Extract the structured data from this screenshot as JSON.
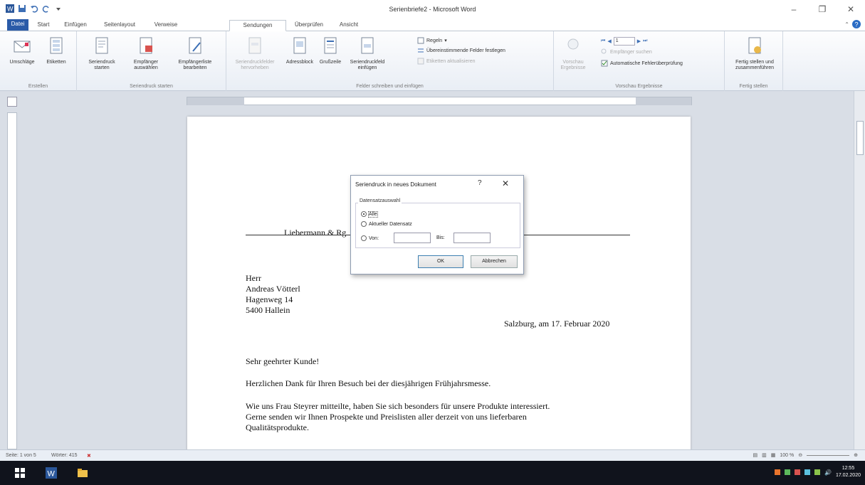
{
  "window": {
    "title": "Serienbriefe2 - Microsoft Word"
  },
  "tabs": [
    {
      "label": "Datei"
    },
    {
      "label": "Start"
    },
    {
      "label": "Einfügen"
    },
    {
      "label": "Seitenlayout"
    },
    {
      "label": "Verweise"
    },
    {
      "label": "Sendungen"
    },
    {
      "label": "Überprüfen"
    },
    {
      "label": "Ansicht"
    }
  ],
  "ribbon": {
    "erstellen": {
      "label": "Erstellen",
      "umschlaege": "Umschläge",
      "etiketten": "Etiketten"
    },
    "seriendruck_starten": {
      "label": "Seriendruck starten",
      "starten": "Seriendruck starten",
      "empfaenger": "Empfänger auswählen",
      "bearbeiten": "Empfängerliste bearbeiten"
    },
    "felder": {
      "label": "Felder schreiben und einfügen",
      "hervorheben": "Seriendruckfelder hervorheben",
      "adressblock": "Adressblock",
      "grusszeile": "Grußzeile",
      "feld_einfuegen": "Seriendruckfeld einfügen",
      "regeln": "Regeln",
      "uebereinstimmen": "Übereinstimmende Felder festlegen",
      "aktualisieren": "Etiketten aktualisieren"
    },
    "vorschau": {
      "label": "Vorschau Ergebnisse",
      "vorschau_btn": "Vorschau Ergebnisse",
      "record": "1",
      "empfaenger_suchen": "Empfänger suchen",
      "fehlerpruefung": "Automatische Fehlerüberprüfung"
    },
    "fertig": {
      "label": "Fertig stellen",
      "btn": "Fertig stellen und zusammenführen"
    }
  },
  "document": {
    "sender": "Liebermann & Rg",
    "recipient": [
      "Herr",
      "Andreas Vötterl",
      "Hagenweg 14",
      "5400   Hallein"
    ],
    "date": "Salzburg, am 17. Februar 2020",
    "salutation": "Sehr geehrter Kunde!",
    "p1": "Herzlichen Dank für Ihren Besuch bei der diesjährigen Frühjahrsmesse.",
    "p2_lines": [
      "Wie uns Frau Steyrer mitteilte, haben Sie sich besonders für unsere Produkte interessiert.",
      "Gerne senden wir Ihnen Prospekte und Preislisten  aller  derzeit von uns lieferbaren",
      "Qualitätsprodukte."
    ]
  },
  "dialog": {
    "title": "Seriendruck in neues Dokument",
    "help": "?",
    "close": "✕",
    "group_label": "Datensatzauswahl",
    "opt_alle": "Alle",
    "opt_aktuell": "Aktueller Datensatz",
    "opt_von": "Von:",
    "bis_label": "Bis:",
    "ok": "OK",
    "cancel": "Abbrechen"
  },
  "status": {
    "page": "Seite: 1 von 5",
    "words": "Wörter: 415",
    "zoom": "100 %"
  },
  "taskbar": {
    "time": "12:55",
    "date": "17.02.2020"
  },
  "colors": {
    "file_tab": "#2a5ba8",
    "word_blue": "#2b579a",
    "taskbar": "#10131c"
  }
}
